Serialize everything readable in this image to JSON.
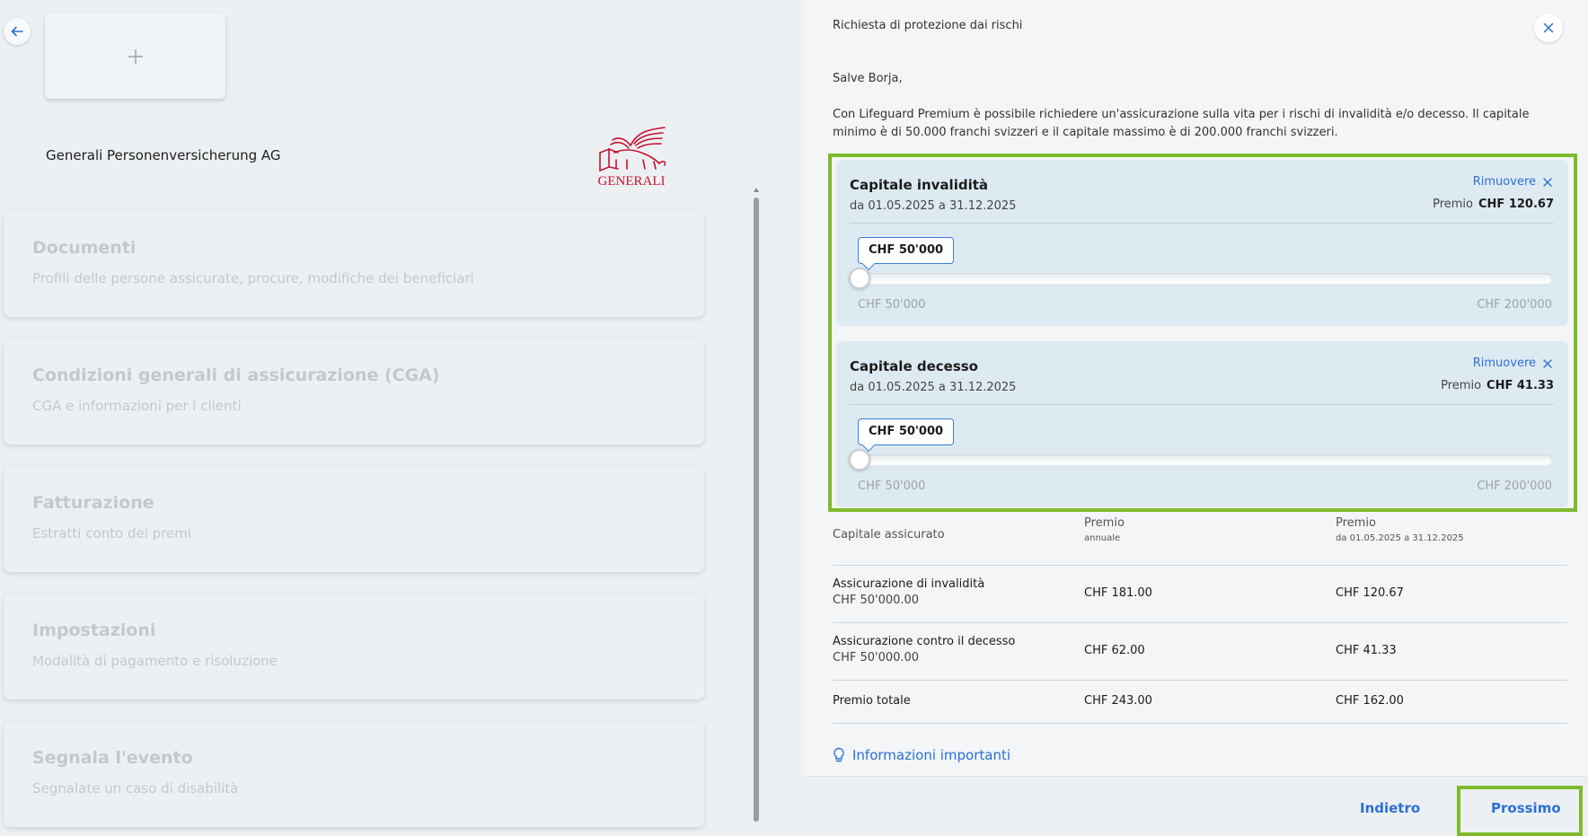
{
  "left": {
    "company_name": "Generali Personenversicherung AG",
    "logo_text": "GENERALI",
    "menu": [
      {
        "title": "Documenti",
        "subtitle": "Profili delle persone assicurate, procure, modifiche dei beneficiari"
      },
      {
        "title": "Condizioni generali di assicurazione (CGA)",
        "subtitle": "CGA e informazioni per i clienti"
      },
      {
        "title": "Fatturazione",
        "subtitle": "Estratti conto dei premi"
      },
      {
        "title": "Impostazioni",
        "subtitle": "Modalità di pagamento e risoluzione"
      },
      {
        "title": "Segnala l'evento",
        "subtitle": "Segnalate un caso di disabilità"
      }
    ]
  },
  "panel": {
    "title": "Richiesta di protezione dai rischi",
    "greeting": "Salve Borja,",
    "intro": "Con Lifeguard Premium è possibile richiedere un'assicurazione sulla vita per i rischi di invalidità e/o decesso. Il capitale minimo è di 50.000 franchi svizzeri e il capitale massimo è di 200.000 franchi svizzeri.",
    "coverages": [
      {
        "title": "Capitale invalidità",
        "remove_label": "Rimuovere",
        "period": "da 01.05.2025 a 31.12.2025",
        "premium_label": "Premio",
        "premium_value": "CHF 120.67",
        "slider_value": "CHF 50'000",
        "slider_min": "CHF 50'000",
        "slider_max": "CHF 200'000",
        "slider_fraction": 0
      },
      {
        "title": "Capitale decesso",
        "remove_label": "Rimuovere",
        "period": "da 01.05.2025 a 31.12.2025",
        "premium_label": "Premio",
        "premium_value": "CHF 41.33",
        "slider_value": "CHF 50'000",
        "slider_min": "CHF 50'000",
        "slider_max": "CHF 200'000",
        "slider_fraction": 0
      }
    ],
    "table": {
      "headers": [
        {
          "label": "Capitale assicurato",
          "sub": ""
        },
        {
          "label": "Premio",
          "sub": "annuale"
        },
        {
          "label": "Premio",
          "sub": "da 01.05.2025 a 31.12.2025"
        }
      ],
      "rows": [
        {
          "name": "Assicurazione di invalidità",
          "capital": "CHF 50'000.00",
          "annual": "CHF 181.00",
          "period": "CHF 120.67"
        },
        {
          "name": "Assicurazione contro il decesso",
          "capital": "CHF 50'000.00",
          "annual": "CHF 62.00",
          "period": "CHF 41.33"
        }
      ],
      "total": {
        "name": "Premio totale",
        "annual": "CHF 243.00",
        "period": "CHF 162.00"
      }
    },
    "info_link": "Informazioni importanti",
    "footer": {
      "back_label": "Indietro",
      "next_label": "Prossimo"
    }
  },
  "colors": {
    "accent": "#2b6fd8",
    "highlight": "#7dbb2b",
    "logo_red": "#c8102e"
  }
}
